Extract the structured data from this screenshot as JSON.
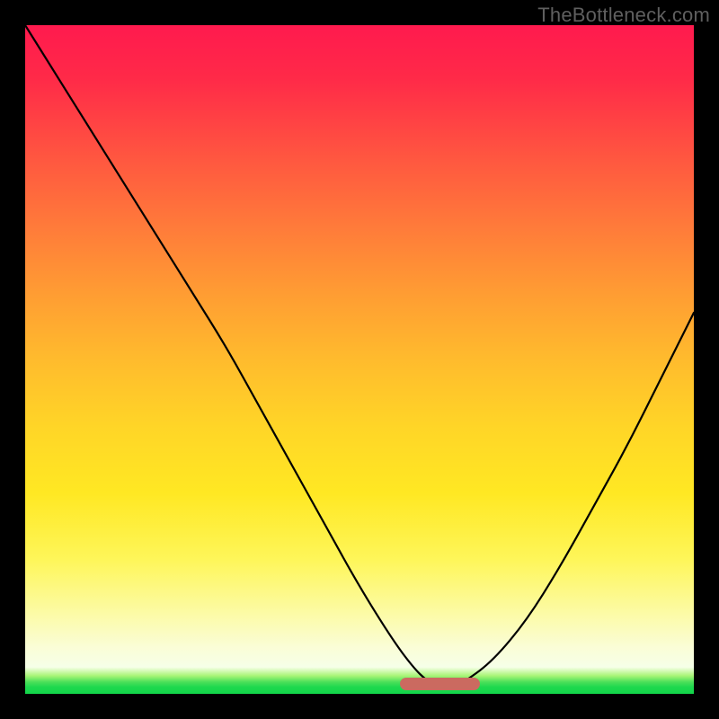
{
  "watermark": "TheBottleneck.com",
  "colors": {
    "frame_bg": "#000000",
    "curve": "#000000",
    "trough_marker": "#cb6a60",
    "watermark_text": "#5f5f5f"
  },
  "chart_data": {
    "type": "line",
    "title": "",
    "xlabel": "",
    "ylabel": "",
    "xlim": [
      0,
      100
    ],
    "ylim": [
      0,
      100
    ],
    "grid": false,
    "legend": false,
    "series": [
      {
        "name": "bottleneck-curve",
        "x": [
          0,
          5,
          10,
          15,
          20,
          25,
          30,
          35,
          40,
          45,
          50,
          55,
          58,
          60,
          62,
          64,
          66,
          70,
          75,
          80,
          85,
          90,
          95,
          100
        ],
        "values": [
          100,
          92,
          84,
          76,
          68,
          60,
          52,
          43,
          34,
          25,
          16,
          8,
          4,
          2,
          1,
          1,
          2,
          5,
          11,
          19,
          28,
          37,
          47,
          57
        ]
      }
    ],
    "annotations": [
      {
        "name": "trough-marker",
        "x_start": 56,
        "x_end": 68,
        "y": 1.5,
        "color": "#cb6a60"
      }
    ],
    "background_gradient": {
      "orientation": "vertical",
      "stops": [
        {
          "y_pct": 0,
          "color": "#ff1a4e"
        },
        {
          "y_pct": 30,
          "color": "#ff7a3a"
        },
        {
          "y_pct": 60,
          "color": "#ffd527"
        },
        {
          "y_pct": 88,
          "color": "#fcfba6"
        },
        {
          "y_pct": 97,
          "color": "#a8f576"
        },
        {
          "y_pct": 100,
          "color": "#12d64a"
        }
      ]
    }
  }
}
